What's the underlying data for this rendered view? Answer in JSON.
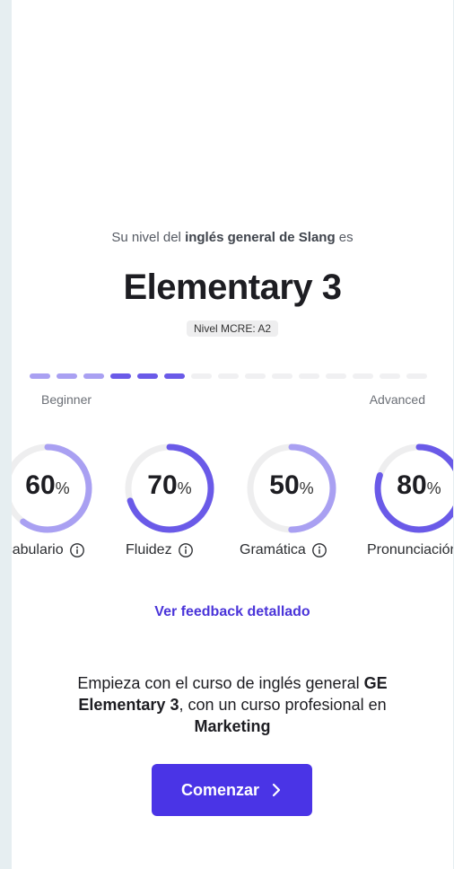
{
  "intro": {
    "prefix": "Su nivel del ",
    "emphasis": "inglés general de Slang",
    "suffix": " es"
  },
  "level": {
    "title": "Elementary 3",
    "cefr_badge": "Nivel MCRE: A2"
  },
  "progress": {
    "total_segments": 15,
    "filled_light": 3,
    "filled_dark": 3,
    "start_label": "Beginner",
    "end_label": "Advanced"
  },
  "skills": [
    {
      "label": "Vocabulario",
      "value": "60",
      "unit": "%",
      "fraction": 0.6,
      "info_icon": "info-circle-icon"
    },
    {
      "label": "Fluidez",
      "value": "70",
      "unit": "%",
      "fraction": 0.7,
      "info_icon": "info-circle-icon"
    },
    {
      "label": "Gramática",
      "value": "50",
      "unit": "%",
      "fraction": 0.5,
      "info_icon": "info-circle-icon"
    },
    {
      "label": "Pronunciación",
      "value": "80",
      "unit": "%",
      "fraction": 0.8
    }
  ],
  "feedback_link": "Ver feedback detallado",
  "recommendation": {
    "part1": "Empieza con el curso de inglés general ",
    "course": "GE Elementary 3",
    "part2": ", con un curso profesional en ",
    "field": "Marketing"
  },
  "start_button": {
    "label": "Comenzar",
    "icon": "chevron-right-icon"
  },
  "colors": {
    "accent": "#4a34e6",
    "ring_light": "#a9a0f2",
    "ring_dark": "#6a5ae8",
    "track": "#eeeeef"
  }
}
